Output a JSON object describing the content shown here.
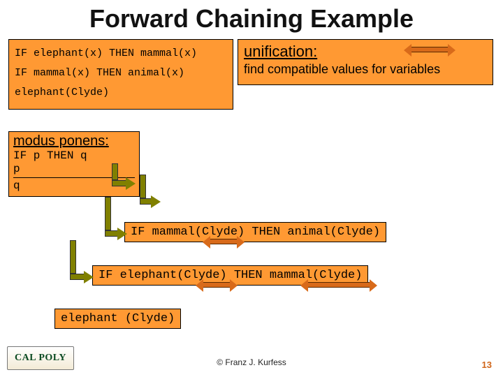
{
  "title": "Forward Chaining Example",
  "rules": {
    "r1": "IF elephant(x) THEN mammal(x)",
    "r2": "IF mammal(x) THEN animal(x)",
    "fact": "elephant(Clyde)"
  },
  "unification": {
    "heading": "unification:",
    "desc": "find compatible values for variables"
  },
  "modus_ponens": {
    "heading": "modus ponens:",
    "rule_line": "IF p THEN q",
    "premise": "p",
    "conclusion": "q"
  },
  "steps": {
    "s3": "IF mammal(Clyde) THEN animal(Clyde)",
    "s2": "IF elephant(Clyde) THEN mammal(Clyde)",
    "s1": "elephant (Clyde)"
  },
  "footer": {
    "copyright": "© Franz J. Kurfess",
    "page": "13",
    "logo_text": "CAL POLY"
  }
}
